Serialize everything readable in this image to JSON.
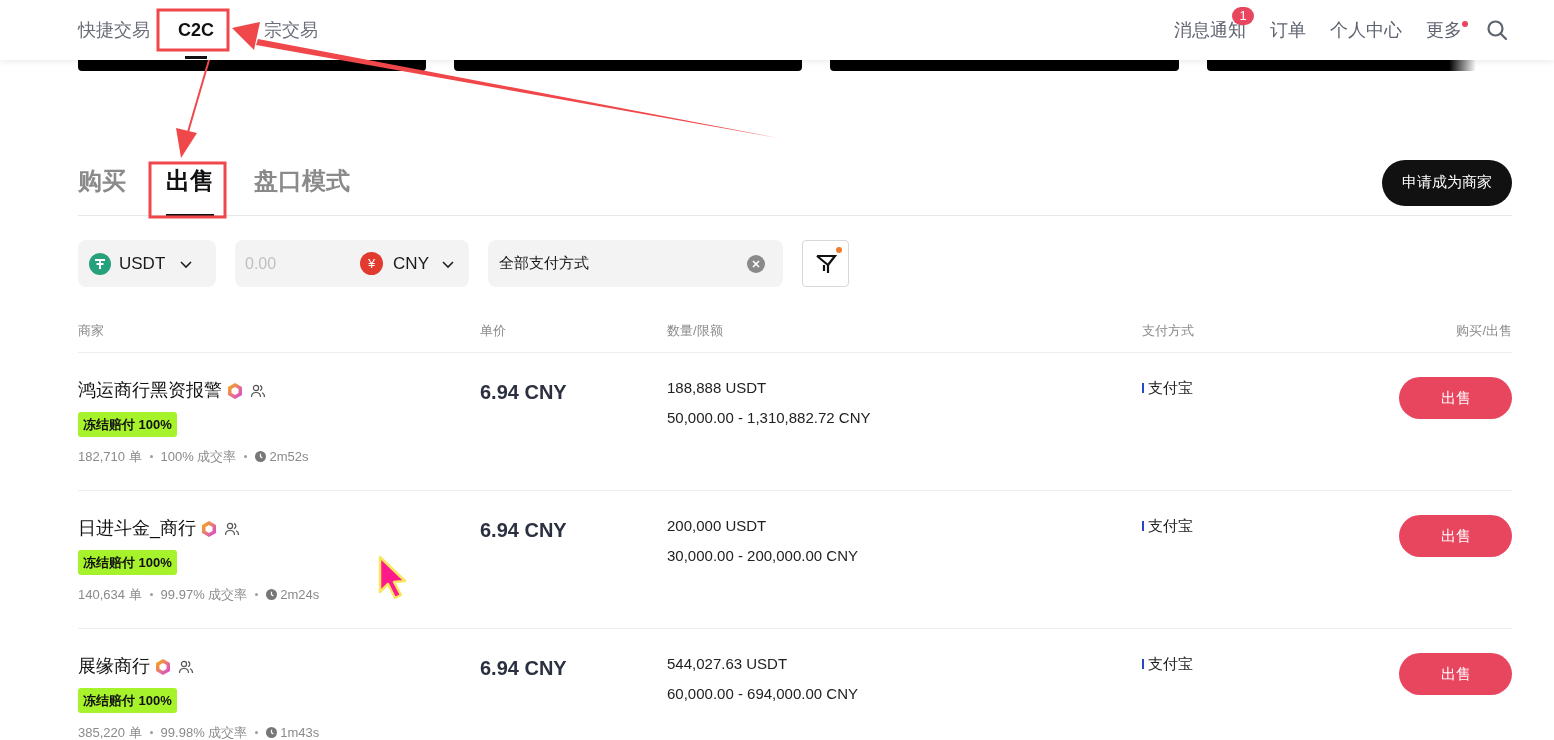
{
  "nav": {
    "tabs": [
      {
        "label": "快捷交易",
        "selected": false
      },
      {
        "label": "C2C",
        "selected": true
      },
      {
        "label": "宗交易",
        "selected": false
      }
    ],
    "items": [
      {
        "label": "消息通知",
        "badge": "1",
        "dot": false
      },
      {
        "label": "订单",
        "dot": false
      },
      {
        "label": "个人中心",
        "dot": false
      },
      {
        "label": "更多",
        "dot": true
      }
    ]
  },
  "tabs": [
    {
      "label": "购买",
      "selected": false
    },
    {
      "label": "出售",
      "selected": true
    },
    {
      "label": "盘口模式",
      "selected": false
    }
  ],
  "apply_button": "申请成为商家",
  "filters": {
    "coin": "USDT",
    "amount_placeholder": "0.00",
    "fiat_symbol": "¥",
    "fiat": "CNY",
    "payment": "全部支付方式",
    "filter_active": true
  },
  "table": {
    "columns": [
      "商家",
      "单价",
      "数量/限额",
      "支付方式",
      "购买/出售"
    ],
    "rows": [
      {
        "merchant": "鸿运商行黑资报警",
        "guarantee": "冻结赔付 100%",
        "orders": "182,710 单",
        "rate": "100% 成交率",
        "time": "2m52s",
        "price": "6.94 CNY",
        "quantity": "188,888 USDT",
        "limit": "50,000.00 - 1,310,882.72 CNY",
        "payment": "支付宝",
        "action": "出售"
      },
      {
        "merchant": "日进斗金_商行",
        "guarantee": "冻结赔付 100%",
        "orders": "140,634 单",
        "rate": "99.97% 成交率",
        "time": "2m24s",
        "price": "6.94 CNY",
        "quantity": "200,000 USDT",
        "limit": "30,000.00 - 200,000.00 CNY",
        "payment": "支付宝",
        "action": "出售"
      },
      {
        "merchant": "展缘商行",
        "guarantee": "冻结赔付 100%",
        "orders": "385,220 单",
        "rate": "99.98% 成交率",
        "time": "1m43s",
        "price": "6.94 CNY",
        "quantity": "544,027.63 USDT",
        "limit": "60,000.00 - 694,000.00 CNY",
        "payment": "支付宝",
        "action": "出售"
      }
    ]
  }
}
